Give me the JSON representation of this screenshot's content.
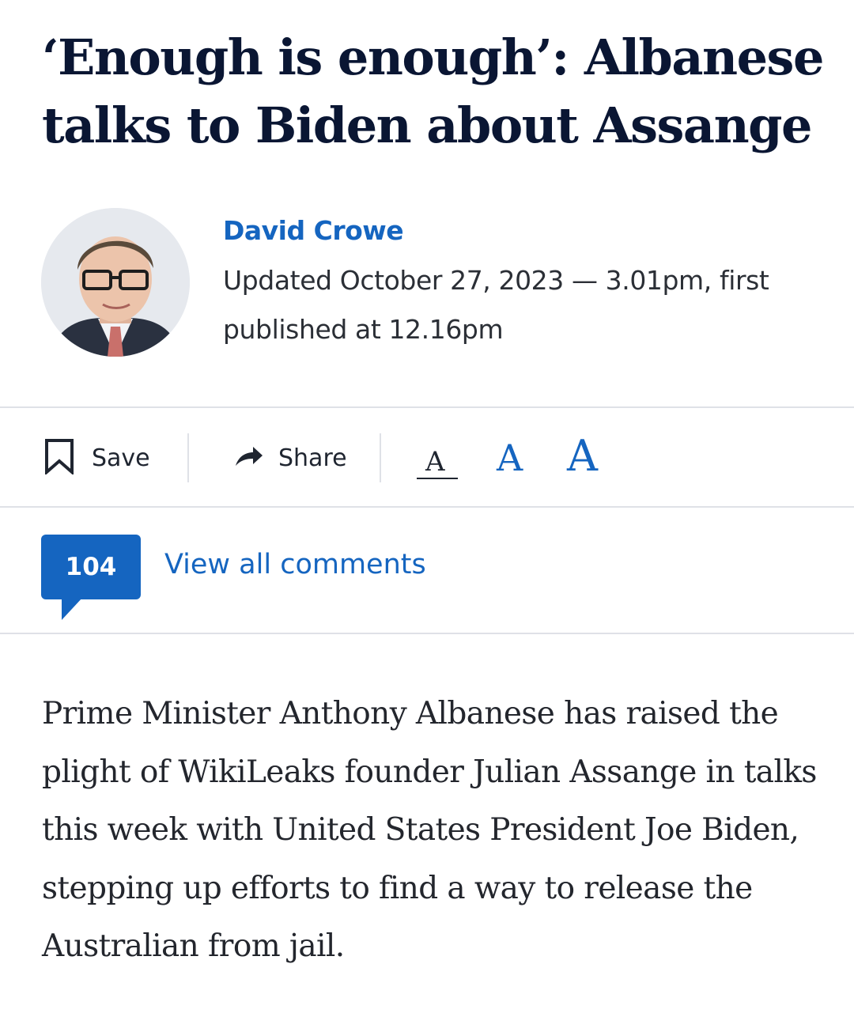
{
  "article": {
    "headline": "‘Enough is enough’: Albanese talks to Biden about Assange",
    "author": "David Crowe",
    "dateline": "Updated October 27, 2023 — 3.01pm, first published at 12.16pm",
    "body": "Prime Minister Anthony Albanese has raised the plight of WikiLeaks founder Julian Assange in talks this week with United States President Joe Biden, stepping up efforts to find a way to release the Australian from jail."
  },
  "toolbar": {
    "save_label": "Save",
    "share_label": "Share",
    "save_icon": "bookmark-icon",
    "share_icon": "share-arrow-icon",
    "font_sizes": [
      "A",
      "A",
      "A"
    ]
  },
  "comments": {
    "count": "104",
    "view_all_label": "View all comments"
  },
  "colors": {
    "accent": "#1565c0",
    "headline": "#0a1633",
    "rule": "#dfe1e7"
  }
}
